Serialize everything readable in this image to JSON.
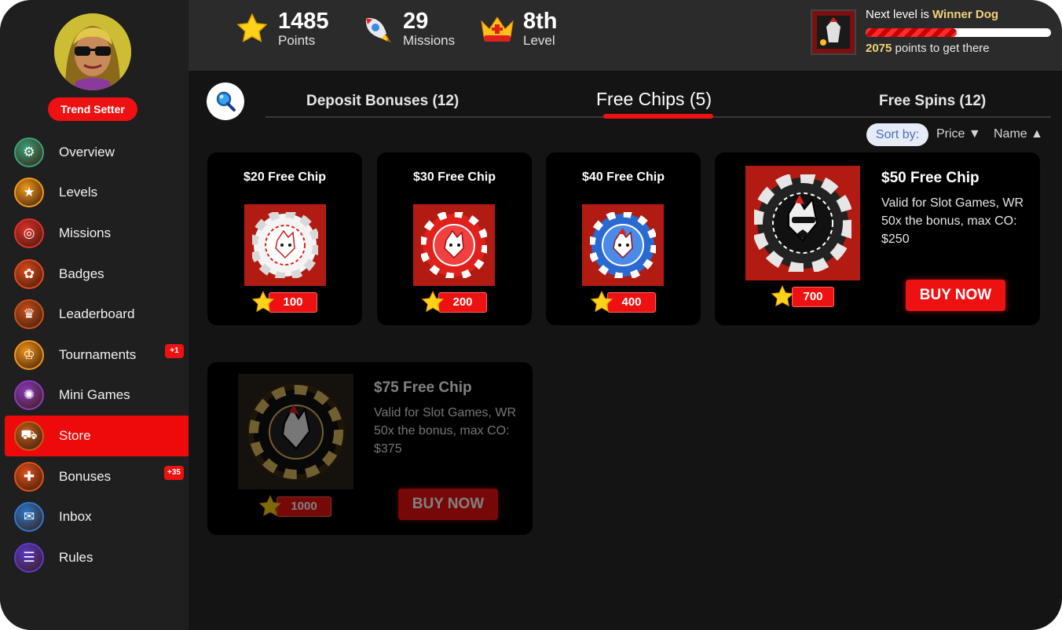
{
  "user": {
    "rank_title": "Trend Setter"
  },
  "sidebar": {
    "items": [
      {
        "label": "Overview",
        "icon": "overview-icon",
        "color": "#3aa37a"
      },
      {
        "label": "Levels",
        "icon": "star-icon",
        "color": "#f29a1a"
      },
      {
        "label": "Missions",
        "icon": "target-icon",
        "color": "#e0302a"
      },
      {
        "label": "Badges",
        "icon": "paw-icon",
        "color": "#e04a1a"
      },
      {
        "label": "Leaderboard",
        "icon": "trophy-icon",
        "color": "#c8501a"
      },
      {
        "label": "Tournaments",
        "icon": "crown-icon",
        "color": "#f0951a",
        "badge": "+1"
      },
      {
        "label": "Mini Games",
        "icon": "wheel-icon",
        "color": "#8a3ac0"
      },
      {
        "label": "Store",
        "icon": "cart-icon",
        "color": "#c0601a",
        "active": true
      },
      {
        "label": "Bonuses",
        "icon": "gift-icon",
        "color": "#e0501a",
        "badge": "+35"
      },
      {
        "label": "Inbox",
        "icon": "inbox-icon",
        "color": "#2a7ad0"
      },
      {
        "label": "Rules",
        "icon": "rules-icon",
        "color": "#5a3ad0"
      }
    ]
  },
  "stats": {
    "points": {
      "value": "1485",
      "label": "Points"
    },
    "missions": {
      "value": "29",
      "label": "Missions"
    },
    "level": {
      "value": "8th",
      "label": "Level"
    }
  },
  "next_level": {
    "prefix": "Next level is ",
    "name": "Winner Dog",
    "points_needed": "2075",
    "points_suffix": " points to get there",
    "progress_fraction": 0.49
  },
  "tabs": [
    {
      "label": "Deposit Bonuses (12)"
    },
    {
      "label": "Free Chips (5)",
      "active": true
    },
    {
      "label": "Free Spins (12)"
    }
  ],
  "sort": {
    "label": "Sort by:",
    "price": "Price ▼",
    "name": "Name ▲"
  },
  "products": [
    {
      "title": "$20 Free Chip",
      "price": "100",
      "chip_color": "#ffffff"
    },
    {
      "title": "$30 Free Chip",
      "price": "200",
      "chip_color": "#e0201a"
    },
    {
      "title": "$40 Free Chip",
      "price": "400",
      "chip_color": "#2a6ad0"
    },
    {
      "title": "$50 Free Chip",
      "price": "700",
      "description": "Valid for Slot Games, WR 50x the bonus, max CO: $250",
      "buy_label": "BUY NOW"
    },
    {
      "title": "$75 Free Chip",
      "price": "1000",
      "description": "Valid for Slot Games, WR 50x the bonus, max CO: $375",
      "buy_label": "BUY NOW"
    }
  ],
  "colors": {
    "accent": "#ee1111",
    "gold": "#f2d27a",
    "background": "#141414"
  }
}
